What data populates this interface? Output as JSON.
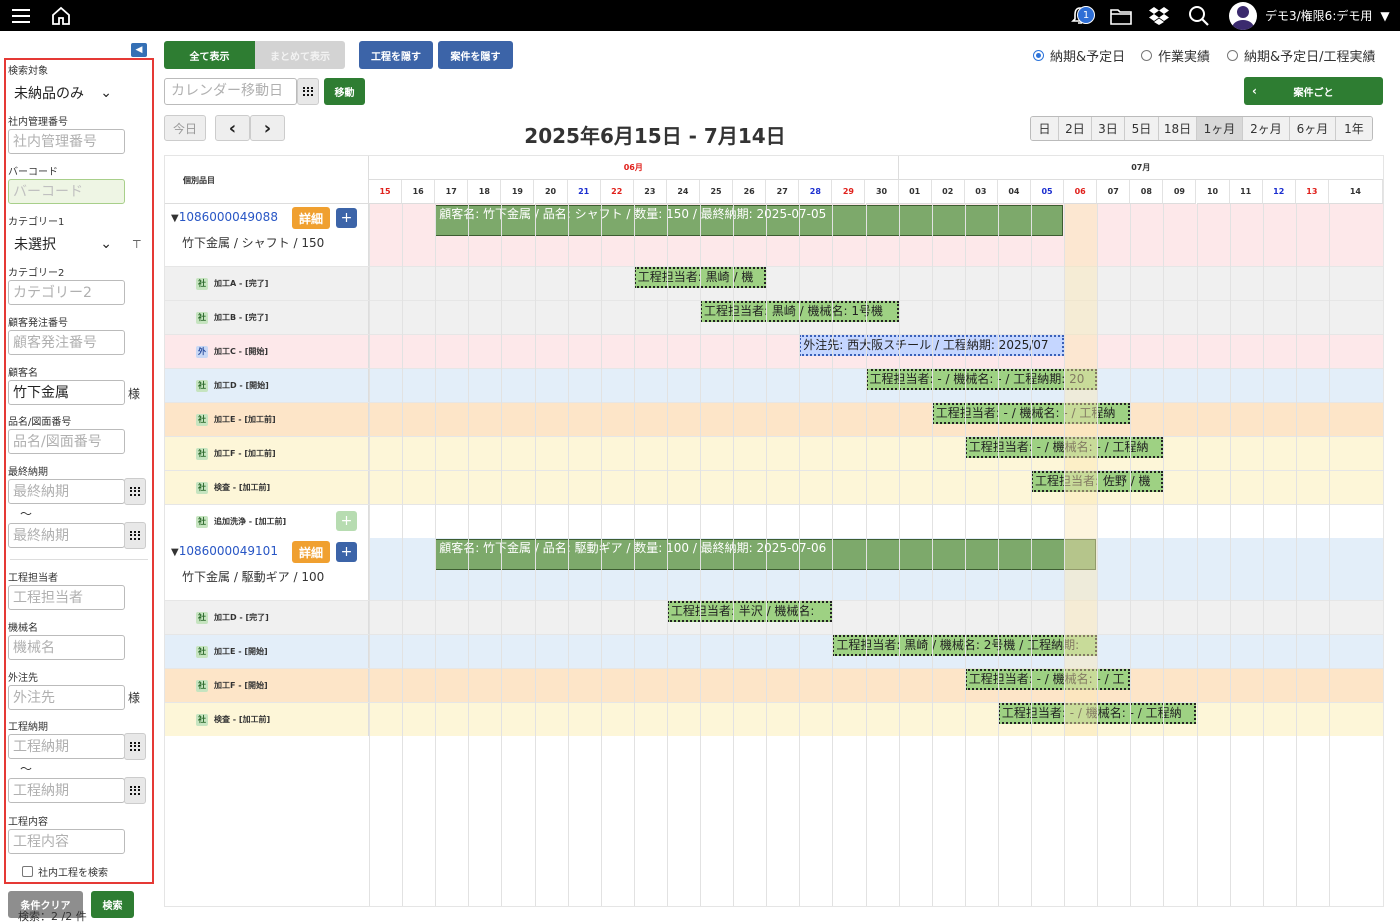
{
  "header": {
    "notification_count": "1",
    "user_name": "デモ3/権限6:デモ用"
  },
  "sidebar": {
    "search_target": {
      "label": "検索対象",
      "value": "未納品のみ"
    },
    "internal_no": {
      "label": "社内管理番号",
      "placeholder": "社内管理番号"
    },
    "barcode": {
      "label": "バーコード",
      "placeholder": "バーコード"
    },
    "category1": {
      "label": "カテゴリー1",
      "value": "未選択"
    },
    "category2": {
      "label": "カテゴリー2",
      "placeholder": "カテゴリー2"
    },
    "customer_order": {
      "label": "顧客発注番号",
      "placeholder": "顧客発注番号"
    },
    "customer": {
      "label": "顧客名",
      "value": "竹下金属",
      "suffix": "様"
    },
    "product": {
      "label": "品名/図面番号",
      "placeholder": "品名/図面番号"
    },
    "final_due": {
      "label": "最終納期",
      "placeholder_from": "最終納期",
      "placeholder_to": "最終納期",
      "tilde": "〜"
    },
    "worker": {
      "label": "工程担当者",
      "placeholder": "工程担当者"
    },
    "machine": {
      "label": "機械名",
      "placeholder": "機械名"
    },
    "outsource": {
      "label": "外注先",
      "placeholder": "外注先",
      "suffix": "様"
    },
    "process_due": {
      "label": "工程納期",
      "placeholder_from": "工程納期",
      "placeholder_to": "工程納期",
      "tilde": "〜"
    },
    "process_content": {
      "label": "工程内容",
      "placeholder": "工程内容"
    },
    "internal_check": "社内工程を検索",
    "clear_button": "条件クリア",
    "search_button": "検索"
  },
  "toolbar": {
    "show_all": "全て表示",
    "show_grouped": "まとめて表示",
    "hide_process": "工程を隠す",
    "hide_case": "案件を隠す",
    "radio": [
      "納期&予定日",
      "作業実績",
      "納期&予定日/工程実績"
    ],
    "cal_placeholder": "カレンダー移動日",
    "move": "移動",
    "per_case": "案件ごと",
    "today": "今日",
    "prev": "‹",
    "next": "›",
    "range_title": "2025年6月15日 - 7月14日",
    "ranges": [
      "日",
      "2日",
      "3日",
      "5日",
      "18日",
      "1ヶ月",
      "2ヶ月",
      "6ヶ月",
      "1年"
    ],
    "active_range": "1ヶ月"
  },
  "gantt": {
    "left_header": "個別品目",
    "months": [
      "06月",
      "07月"
    ],
    "days": [
      {
        "d": "15",
        "c": "red"
      },
      {
        "d": "16",
        "c": ""
      },
      {
        "d": "17",
        "c": ""
      },
      {
        "d": "18",
        "c": ""
      },
      {
        "d": "19",
        "c": ""
      },
      {
        "d": "20",
        "c": ""
      },
      {
        "d": "21",
        "c": "blue"
      },
      {
        "d": "22",
        "c": "red"
      },
      {
        "d": "23",
        "c": ""
      },
      {
        "d": "24",
        "c": ""
      },
      {
        "d": "25",
        "c": ""
      },
      {
        "d": "26",
        "c": ""
      },
      {
        "d": "27",
        "c": ""
      },
      {
        "d": "28",
        "c": "blue"
      },
      {
        "d": "29",
        "c": "red"
      },
      {
        "d": "30",
        "c": ""
      },
      {
        "d": "01",
        "c": ""
      },
      {
        "d": "02",
        "c": ""
      },
      {
        "d": "03",
        "c": ""
      },
      {
        "d": "04",
        "c": ""
      },
      {
        "d": "05",
        "c": "blue"
      },
      {
        "d": "06",
        "c": "red"
      },
      {
        "d": "07",
        "c": ""
      },
      {
        "d": "08",
        "c": ""
      },
      {
        "d": "09",
        "c": ""
      },
      {
        "d": "10",
        "c": ""
      },
      {
        "d": "11",
        "c": ""
      },
      {
        "d": "12",
        "c": "blue"
      },
      {
        "d": "13",
        "c": "red"
      },
      {
        "d": "14",
        "c": ""
      }
    ],
    "projects": [
      {
        "id": "1086000049088",
        "detail": "詳細",
        "sub": "竹下金属 / シャフト / 150",
        "bar": "顧客名: 竹下金属 / 品名: シャフト / 数量: 150 / 最終納期: 2025-07-05",
        "processes": [
          {
            "tag": "社",
            "label": "加工A - [完了]",
            "bar": "工程担当者: 黒崎 / 機"
          },
          {
            "tag": "社",
            "label": "加工B - [完了]",
            "bar": "工程担当者: 黒崎 / 機械名: 1号機"
          },
          {
            "tag": "外",
            "label": "加工C - [開始]",
            "bar": "外注先: 西大阪スチール / 工程納期: 2025/07"
          },
          {
            "tag": "社",
            "label": "加工D - [開始]",
            "bar": "工程担当者: - / 機械名: - / 工程納期: 20"
          },
          {
            "tag": "社",
            "label": "加工E - [加工前]",
            "bar": "工程担当者: - / 機械名: - / 工程納"
          },
          {
            "tag": "社",
            "label": "加工F - [加工前]",
            "bar": "工程担当者: - / 機械名: - / 工程納"
          },
          {
            "tag": "社",
            "label": "検査 - [加工前]",
            "bar": "工程担当者: 佐野 / 機"
          },
          {
            "tag": "社",
            "label": "追加洗浄 - [加工前]",
            "bar": ""
          }
        ]
      },
      {
        "id": "1086000049101",
        "detail": "詳細",
        "sub": "竹下金属 / 駆動ギア / 100",
        "bar": "顧客名: 竹下金属 / 品名: 駆動ギア / 数量: 100 / 最終納期: 2025-07-06",
        "processes": [
          {
            "tag": "社",
            "label": "加工D - [完了]",
            "bar": "工程担当者: 半沢 / 機械名:"
          },
          {
            "tag": "社",
            "label": "加工E - [開始]",
            "bar": "工程担当者: 黒崎 / 機械名: 2号機 / 工程納期:"
          },
          {
            "tag": "社",
            "label": "加工F - [開始]",
            "bar": "工程担当者: - / 機械名: - / 工"
          },
          {
            "tag": "社",
            "label": "検査 - [加工前]",
            "bar": "工程担当者: - / 機械名: - / 工程納"
          }
        ]
      }
    ],
    "status": "検索：2 /2 件"
  },
  "colors": {
    "green_button": "#2e7d32",
    "blue_button": "#3c64a8",
    "detail_orange": "#f0a030",
    "main_bar": "#7da96b",
    "process_bar": "#9ed183",
    "outsource_bar": "#c5d6ff"
  }
}
